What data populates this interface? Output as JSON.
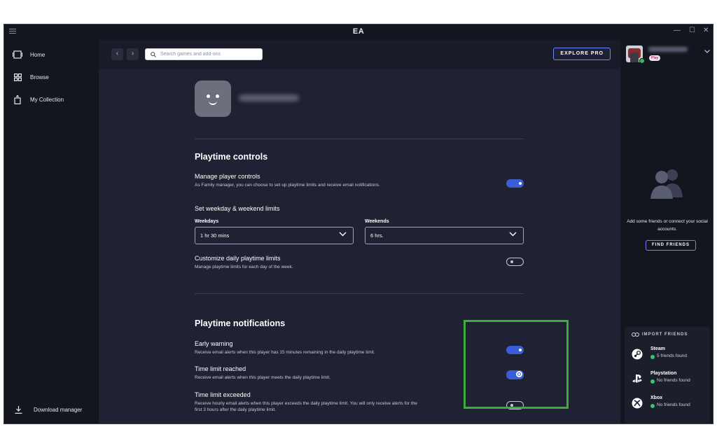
{
  "window": {
    "title": "EA"
  },
  "sidebar": {
    "items": [
      {
        "label": "Home",
        "icon": "home-icon"
      },
      {
        "label": "Browse",
        "icon": "grid-icon"
      },
      {
        "label": "My Collection",
        "icon": "collection-icon"
      }
    ],
    "download_label": "Download manager"
  },
  "topbar": {
    "search_placeholder": "Search games and add-ons",
    "explore_label": "EXPLORE PRO"
  },
  "profile": {
    "badge": "Play"
  },
  "playtime_controls": {
    "title": "Playtime controls",
    "manage": {
      "label": "Manage player controls",
      "desc": "As Family manager, you can choose to set up playtime limits and receive email notifications.",
      "enabled": true
    },
    "limits_title": "Set weekday & weekend limits",
    "weekdays": {
      "label": "Weekdays",
      "value": "1 hr 30 mins"
    },
    "weekends": {
      "label": "Weekends",
      "value": "6 hrs."
    },
    "customize": {
      "label": "Customize daily playtime limits",
      "desc": "Manage playtime limits for each day of the week.",
      "enabled": false
    }
  },
  "playtime_notifications": {
    "title": "Playtime notifications",
    "items": [
      {
        "label": "Early warning",
        "desc": "Receive email alerts when this player has 15 minutes remaining in the daily playtime limit.",
        "enabled": true
      },
      {
        "label": "Time limit reached",
        "desc": "Receive email alerts when this player meets the daily playtime limit.",
        "enabled": true
      },
      {
        "label": "Time limit exceeded",
        "desc": "Receive hourly email alerts when this player exceeds the daily playtime limit. You will only receive alerts for the first 3 hours after the daily playtime limit.",
        "enabled": false
      }
    ]
  },
  "friends": {
    "empty_text": "Add some friends or connect your social accounts.",
    "find_label": "FIND FRIENDS",
    "import_title": "IMPORT FRIENDS",
    "services": [
      {
        "name": "Steam",
        "status": "5 friends found",
        "icon": "steam-icon"
      },
      {
        "name": "Playstation",
        "status": "No friends found",
        "icon": "playstation-icon"
      },
      {
        "name": "Xbox",
        "status": "No friends found",
        "icon": "xbox-icon"
      }
    ]
  },
  "colors": {
    "accent": "#3a5dd8",
    "highlight": "#3cac3c",
    "background": "#1f2233",
    "sidebar": "#14161f"
  }
}
